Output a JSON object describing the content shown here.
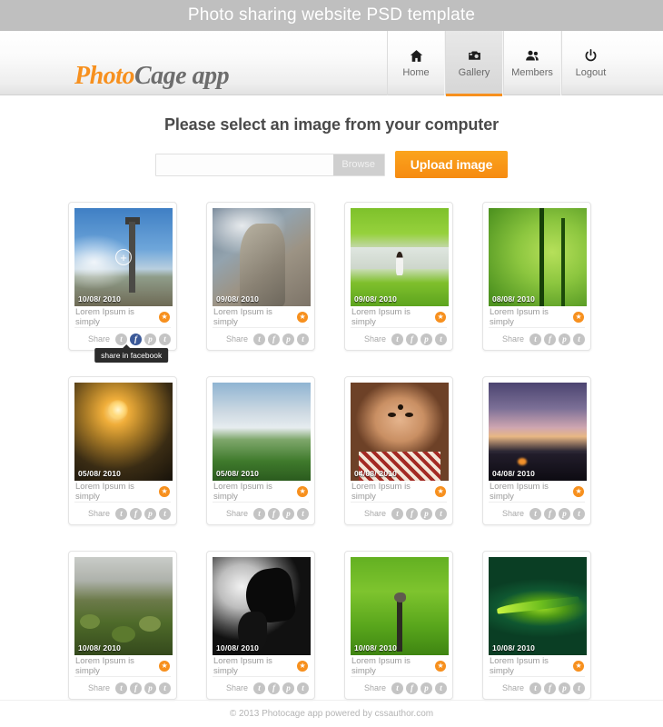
{
  "banner": {
    "title": "Photo sharing website PSD template"
  },
  "header": {
    "logo": {
      "part1": "Photo",
      "part2": "Cage app"
    },
    "nav": [
      {
        "label": "Home",
        "icon": "home-icon",
        "active": false
      },
      {
        "label": "Gallery",
        "icon": "camera-icon",
        "active": true
      },
      {
        "label": "Members",
        "icon": "people-icon",
        "active": false
      },
      {
        "label": "Logout",
        "icon": "power-icon",
        "active": false
      }
    ]
  },
  "upload": {
    "heading": "Please select an image from your computer",
    "file_value": "",
    "file_placeholder": "",
    "browse_label": "Browse",
    "submit_label": "Upload image"
  },
  "gallery": {
    "share_label": "Share",
    "social": [
      {
        "name": "twitter-icon",
        "glyph": "t"
      },
      {
        "name": "facebook-icon",
        "glyph": "f"
      },
      {
        "name": "pinterest-icon",
        "glyph": "p"
      },
      {
        "name": "tumblr-icon",
        "glyph": "t"
      }
    ],
    "tooltip": "share in facebook",
    "items": [
      {
        "date": "10/08/ 2010",
        "caption": "Lorem Ipsum is simply",
        "art": "art-pillar",
        "alt": "stone pillar on hilltop",
        "overlay": true,
        "tooltip": true,
        "highlight_social": 1
      },
      {
        "date": "09/08/ 2010",
        "caption": "Lorem Ipsum is simply",
        "art": "art-statue",
        "alt": "large stone statue",
        "overlay": false,
        "tooltip": false,
        "highlight_social": -1
      },
      {
        "date": "09/08/ 2010",
        "caption": "Lorem Ipsum is simply",
        "art": "art-paddy",
        "alt": "woman in paddy field",
        "overlay": false,
        "tooltip": false,
        "highlight_social": -1
      },
      {
        "date": "08/08/ 2010",
        "caption": "Lorem Ipsum is simply",
        "art": "art-bamboo",
        "alt": "bamboo plants",
        "overlay": false,
        "tooltip": false,
        "highlight_social": -1
      },
      {
        "date": "05/08/ 2010",
        "caption": "Lorem Ipsum is simply",
        "art": "art-sunset-lake",
        "alt": "sunset over lake",
        "overlay": false,
        "tooltip": false,
        "highlight_social": -1
      },
      {
        "date": "05/08/ 2010",
        "caption": "Lorem Ipsum is simply",
        "art": "art-hill",
        "alt": "green hill and clouds",
        "overlay": false,
        "tooltip": false,
        "highlight_social": -1
      },
      {
        "date": "04/08/ 2010",
        "caption": "Lorem Ipsum is simply",
        "art": "art-girl",
        "alt": "portrait of young girl",
        "overlay": false,
        "tooltip": false,
        "highlight_social": -1
      },
      {
        "date": "04/08/ 2010",
        "caption": "Lorem Ipsum is simply",
        "art": "art-dusk-city",
        "alt": "city skyline at dusk",
        "overlay": false,
        "tooltip": false,
        "highlight_social": -1
      },
      {
        "date": "10/08/ 2010",
        "caption": "Lorem Ipsum is simply",
        "art": "art-mossy",
        "alt": "mossy rocks by water",
        "overlay": false,
        "tooltip": false,
        "highlight_social": -1
      },
      {
        "date": "10/08/ 2010",
        "caption": "Lorem Ipsum is simply",
        "art": "art-butterfly",
        "alt": "butterfly silhouette",
        "overlay": false,
        "tooltip": false,
        "highlight_social": -1
      },
      {
        "date": "10/08/ 2010",
        "caption": "Lorem Ipsum is simply",
        "art": "art-bird-grass",
        "alt": "bird on post in grass",
        "overlay": false,
        "tooltip": false,
        "highlight_social": -1
      },
      {
        "date": "10/08/ 2010",
        "caption": "Lorem Ipsum is simply",
        "art": "art-leaf",
        "alt": "green leaf on dark",
        "overlay": false,
        "tooltip": false,
        "highlight_social": -1
      }
    ]
  },
  "footer": {
    "text": "© 2013 Photocage app  powered by cssauthor.com"
  },
  "colors": {
    "accent": "#f7901e",
    "banner": "#bfbfbf",
    "facebook": "#3b5998",
    "muted": "#9a9a9a"
  }
}
